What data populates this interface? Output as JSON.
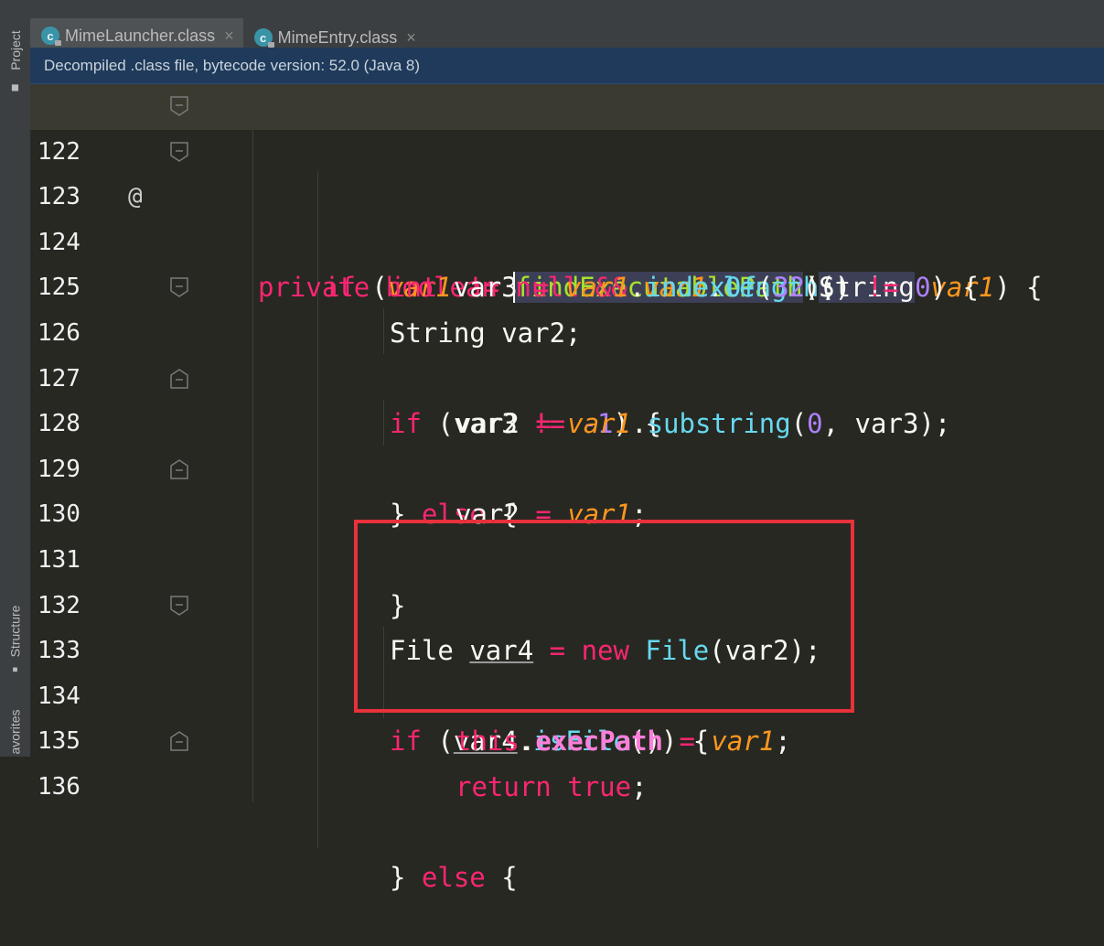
{
  "sidebar": {
    "tabs": [
      {
        "label": "Project",
        "icon": "folder-icon"
      },
      {
        "label": "Structure",
        "icon": "structure-icon"
      },
      {
        "label": "avorites",
        "icon": "star-icon"
      }
    ]
  },
  "tabs": [
    {
      "label": "MimeLauncher.class",
      "icon": "class-file-icon",
      "active": true
    },
    {
      "label": "MimeEntry.class",
      "icon": "class-file-icon",
      "active": false
    }
  ],
  "banner": {
    "text": "Decompiled .class file, bytecode version: 52.0 (Java 8)"
  },
  "editor": {
    "lines": [
      {
        "no": "122"
      },
      {
        "no": "123"
      },
      {
        "no": "124"
      },
      {
        "no": "125"
      },
      {
        "no": "126"
      },
      {
        "no": "127"
      },
      {
        "no": "128"
      },
      {
        "no": "129"
      },
      {
        "no": "130"
      },
      {
        "no": "131"
      },
      {
        "no": "132"
      },
      {
        "no": "133"
      },
      {
        "no": "134"
      },
      {
        "no": "135"
      },
      {
        "no": "136"
      }
    ],
    "override_marker": "@",
    "code": {
      "l122": {
        "kw1": "private",
        "kw2": "boolean",
        "fn": "findExecutablePath",
        "p1": "(",
        "type": "String",
        "param": "var1",
        "p2": ") {"
      },
      "l123": {
        "kw": "if",
        "a": " (",
        "v1": "var1",
        "op1": " != ",
        "null": "null",
        "and": " && ",
        "v2": "var1",
        "dot": ".",
        "call": "length",
        "b": "() ",
        "op2": "!=",
        "sp": " ",
        "zero": "0",
        "c": ") {"
      },
      "l124": {
        "kw": "int",
        "a": " var3 ",
        "eq": "=",
        "sp": " ",
        "v": "var1",
        "dot": ".",
        "call": "indexOf",
        "b": "(",
        "num": "32",
        "c": ");"
      },
      "l125": {
        "a": "String var2;"
      },
      "l126": {
        "kw": "if",
        "a": " (var3 ",
        "op": "!=",
        "sp": " ",
        "num": "-1",
        "c": ") {"
      },
      "l127": {
        "a": "var2 ",
        "eq": "=",
        "sp": " ",
        "v": "var1",
        "dot": ".",
        "call": "substring",
        "b": "(",
        "num": "0",
        "c": ", var3);"
      },
      "l128": {
        "a": "} ",
        "kw": "else",
        "c": " {"
      },
      "l129": {
        "a": "var2 ",
        "eq": "=",
        "sp": " ",
        "v": "var1",
        "c": ";"
      },
      "l130": {
        "a": "}"
      },
      "l132": {
        "a": "File ",
        "v": "var4",
        "b": " ",
        "eq": "=",
        "sp": " ",
        "kw": "new",
        "sp2": " ",
        "typ": "File",
        "c": "(var2);"
      },
      "l133": {
        "kw": "if",
        "a": " (",
        "v": "var4",
        "dot": ".",
        "call": "isFile",
        "c": "()) {"
      },
      "l134": {
        "kw": "this",
        "dot": ".",
        "field": "execPath",
        "sp": " ",
        "eq": "=",
        "sp2": " ",
        "v": "var1",
        "c": ";"
      },
      "l135": {
        "kw": "return",
        "sp": " ",
        "kw2": "true",
        "c": ";"
      },
      "l136": {
        "a": "} ",
        "kw": "else",
        "c": " {"
      }
    }
  },
  "colors": {
    "keyword": "#f92672",
    "parameter": "#fd971f",
    "function": "#a6e22e",
    "method_call": "#66d9ef",
    "number": "#ae81ff",
    "highlight_box": "#e8313a"
  }
}
